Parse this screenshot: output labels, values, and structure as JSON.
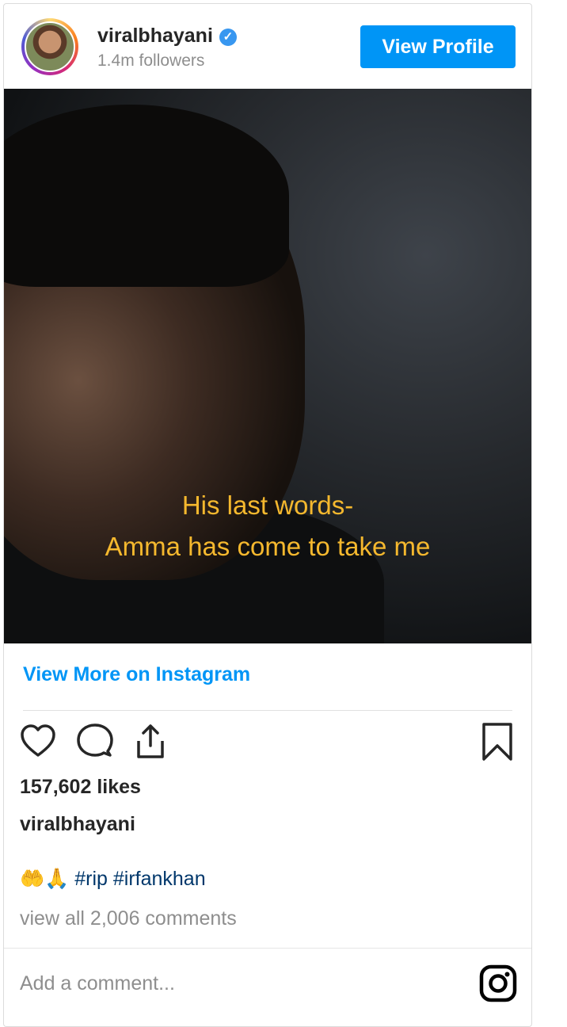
{
  "header": {
    "username": "viralbhayani",
    "followers": "1.4m followers",
    "view_profile_label": "View Profile"
  },
  "post": {
    "caption_overlay": [
      "His last words-",
      "Amma has come to take me"
    ],
    "view_more_label": "View More on Instagram",
    "likes": "157,602 likes",
    "author": "viralbhayani",
    "caption_emoji": "🤲🙏",
    "hashtags": [
      "#rip",
      "#irfankhan"
    ],
    "view_all_comments": "view all 2,006 comments",
    "add_comment_placeholder": "Add a comment..."
  },
  "icons": {
    "verified": "verified-badge-icon",
    "like": "heart-icon",
    "comment": "comment-bubble-icon",
    "share": "share-upload-icon",
    "save": "bookmark-icon",
    "instagram": "instagram-icon"
  },
  "colors": {
    "button_blue": "#0095f6",
    "link_blue": "#0095f6",
    "caption_overlay": "#f5b82e",
    "hashtag": "#00376b",
    "muted_text": "#8e8e8e"
  }
}
